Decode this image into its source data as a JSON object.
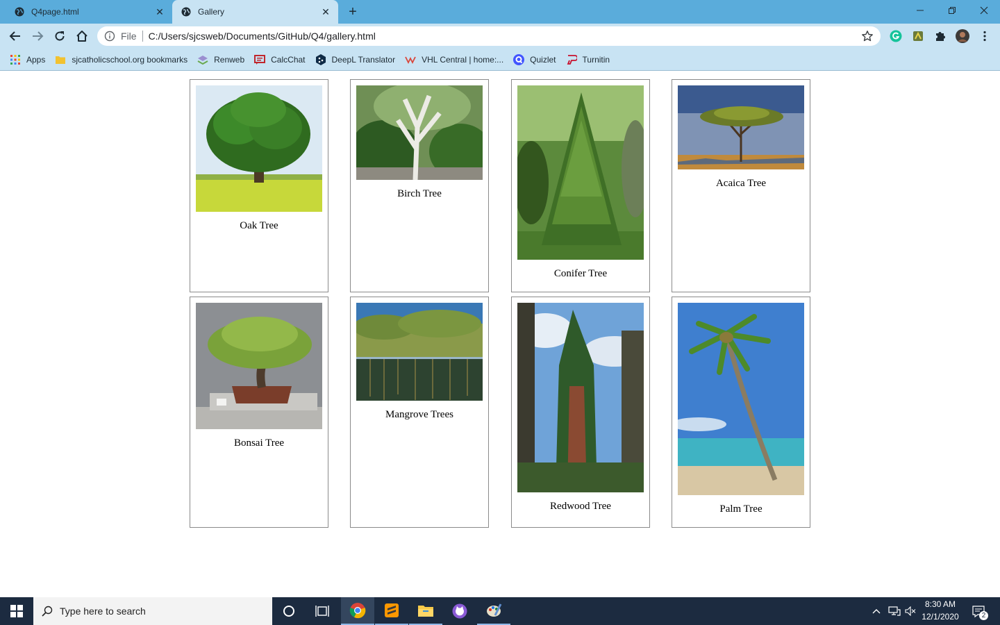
{
  "browser": {
    "tabs": [
      {
        "title": "Q4page.html",
        "active": false
      },
      {
        "title": "Gallery",
        "active": true
      }
    ],
    "url_scheme": "File",
    "url": "C:/Users/sjcsweb/Documents/GitHub/Q4/gallery.html",
    "bookmarks": [
      {
        "label": "Apps",
        "icon": "apps-grid-icon"
      },
      {
        "label": "sjcatholicschool.org bookmarks",
        "icon": "folder-icon"
      },
      {
        "label": "Renweb",
        "icon": "renweb-icon"
      },
      {
        "label": "CalcChat",
        "icon": "calcchat-icon"
      },
      {
        "label": "DeepL Translator",
        "icon": "deepl-icon"
      },
      {
        "label": "VHL Central | home:...",
        "icon": "vhl-icon"
      },
      {
        "label": "Quizlet",
        "icon": "quizlet-icon"
      },
      {
        "label": "Turnitin",
        "icon": "turnitin-icon"
      }
    ]
  },
  "gallery": {
    "items": [
      {
        "caption": "Oak Tree"
      },
      {
        "caption": "Birch Tree"
      },
      {
        "caption": "Conifer Tree"
      },
      {
        "caption": "Acaica Tree"
      },
      {
        "caption": "Bonsai Tree"
      },
      {
        "caption": "Mangrove Trees"
      },
      {
        "caption": "Redwood Tree"
      },
      {
        "caption": "Palm Tree"
      }
    ]
  },
  "taskbar": {
    "search_placeholder": "Type here to search",
    "time": "8:30 AM",
    "date": "12/1/2020",
    "notification_count": "2"
  },
  "colors": {
    "titlebar": "#5aacdb",
    "toolbar": "#c8e3f3",
    "taskbar": "#1c2b40"
  }
}
